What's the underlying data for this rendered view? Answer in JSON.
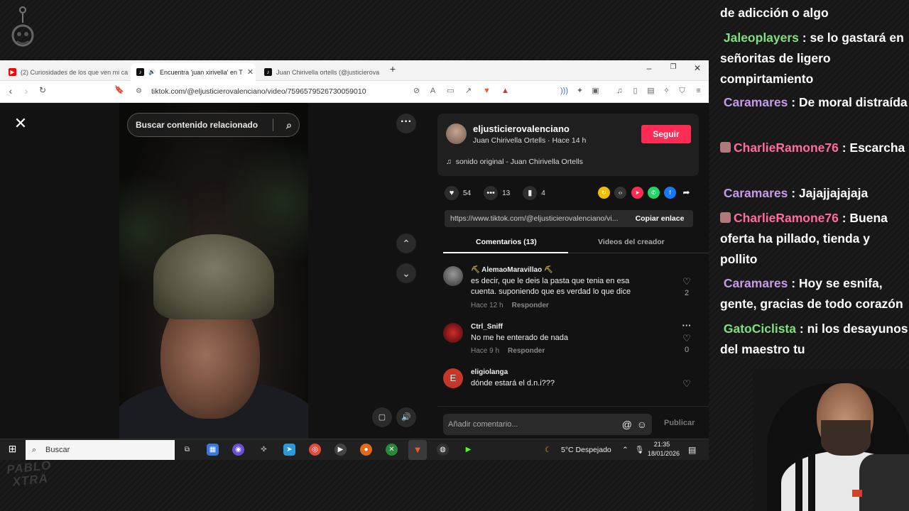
{
  "browser": {
    "tabs": [
      {
        "label": "(2) Curiosidades de los que ven mi ca",
        "icon": "youtube-icon",
        "color": "#ff0000"
      },
      {
        "label": "Encuentra 'juan xirivella' en T",
        "icon": "tiktok-icon",
        "color": "#000000"
      },
      {
        "label": "Juan Chirivella ortells (@justicierova",
        "icon": "tiktok-icon",
        "color": "#000000"
      }
    ],
    "url": "tiktok.com/@eljusticierovalenciano/video/7596579526730059010"
  },
  "tiktok": {
    "search_placeholder": "Buscar contenido relacionado",
    "author": {
      "username": "eljusticierovalenciano",
      "subtitle": "Juan Chirivella Ortells · Hace 14 h",
      "follow_label": "Seguir",
      "sound": "sonido original - Juan Chirivella Ortells"
    },
    "stats": {
      "likes": "54",
      "comments": "13",
      "saves": "4"
    },
    "share_link": "https://www.tiktok.com/@eljusticierovalenciano/vi...",
    "copy_label": "Copiar enlace",
    "tabs": {
      "comments": "Comentarios (13)",
      "creator_videos": "Videos del creador"
    },
    "comments": [
      {
        "user": "AlemaoMaravillao",
        "text": "es decir, que le deis la pasta que tenia en esa cuenta. suponiendo que es verdad lo que dice",
        "time": "Hace 12 h",
        "reply": "Responder",
        "likes": "2"
      },
      {
        "user": "Ctrl_Sniff",
        "text": "No me he enterado de nada",
        "time": "Hace 9 h",
        "reply": "Responder",
        "likes": "0"
      },
      {
        "user": "eligiolanga",
        "text": "dónde estará el d.n.i???",
        "avatar_letter": "E"
      }
    ],
    "composer": {
      "placeholder": "Añadir comentario...",
      "publish": "Publicar"
    }
  },
  "taskbar": {
    "search": "Buscar",
    "weather": "5°C  Despejado",
    "time": "21:35",
    "date": "18/01/2026"
  },
  "chat": [
    {
      "nick": "",
      "text": "de adicción o algo"
    },
    {
      "nick": "Jaleoplayers",
      "text": "se lo gastará en señoritas de ligero compirtamiento",
      "color": "#7ee07e"
    },
    {
      "nick": "Caramares",
      "text": "De moral distraída",
      "color": "#c49be8"
    },
    {
      "nick": "CharlieRamone76",
      "text": "Escarcha",
      "color": "#ff6b9a"
    },
    {
      "nick": "Caramares",
      "text": "Jajajjajajaja",
      "color": "#c49be8"
    },
    {
      "nick": "CharlieRamone76",
      "text": "Buena oferta ha pillado, tienda y pollito",
      "color": "#ff6b9a"
    },
    {
      "nick": "Caramares",
      "text": "Hoy se esnifa, gente, gracias de todo corazón",
      "color": "#c49be8"
    },
    {
      "nick": "GatoCiclista",
      "text": "ni los desayunos del maestro tu",
      "color": "#7ee07e"
    }
  ]
}
